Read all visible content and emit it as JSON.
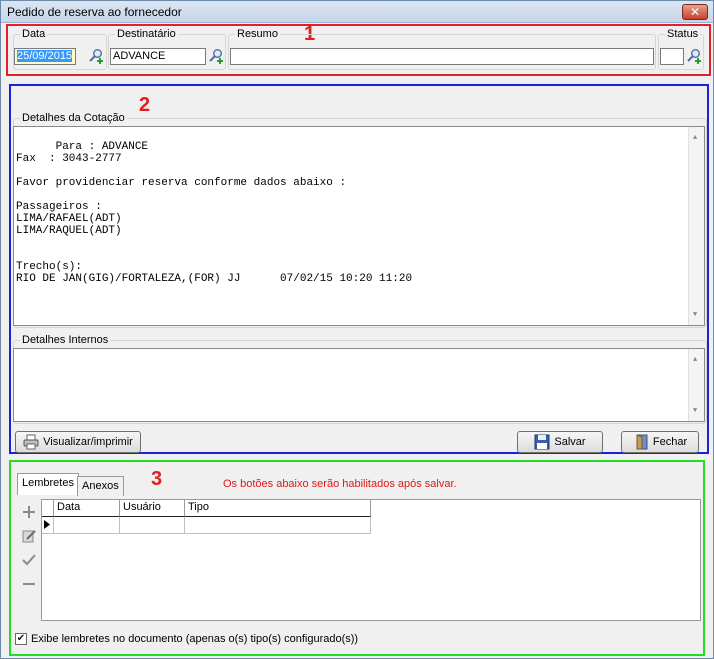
{
  "window": {
    "title": "Pedido de reserva ao fornecedor",
    "close": "✕"
  },
  "markers": {
    "one": "1",
    "two": "2",
    "three": "3"
  },
  "header": {
    "data_label": "Data",
    "data_value": "25/09/2015",
    "destinatario_label": "Destinatário",
    "destinatario_value": "ADVANCE",
    "resumo_label": "Resumo",
    "resumo_value": "",
    "status_label": "Status",
    "status_value": ""
  },
  "detalhes_cotacao": {
    "label": "Detalhes da Cotação",
    "text": "Para : ADVANCE\nFax  : 3043-2777\n\nFavor providenciar reserva conforme dados abaixo :\n\nPassageiros :\nLIMA/RAFAEL(ADT)\nLIMA/RAQUEL(ADT)\n\n\nTrecho(s):\nRIO DE JAN(GIG)/FORTALEZA,(FOR) JJ      07/02/15 10:20 11:20"
  },
  "detalhes_internos": {
    "label": "Detalhes Internos",
    "text": ""
  },
  "buttons": {
    "visualizar": "Visualizar/imprimir",
    "salvar": "Salvar",
    "fechar": "Fechar"
  },
  "tabs": {
    "lembretes": "Lembretes",
    "anexos": "Anexos"
  },
  "notice": "Os botões abaixo serão habilitados após salvar.",
  "grid": {
    "columns": [
      "Data",
      "Usuário",
      "Tipo"
    ],
    "rows": [
      [
        "",
        "",
        ""
      ]
    ]
  },
  "footer": {
    "checkbox_label": "Exibe lembretes no documento (apenas o(s) tipo(s) configurado(s))",
    "checked": true
  },
  "colors": {
    "section1": "#e0202a",
    "section2": "#1a23d8",
    "section3": "#22dd22",
    "notice": "#e01818",
    "selection": "#3399ff"
  },
  "icons": [
    "search-add-icon",
    "printer-icon",
    "floppy-disk-icon",
    "door-exit-icon",
    "plus-icon",
    "edit-icon",
    "check-icon",
    "minus-icon",
    "row-pointer-icon"
  ]
}
